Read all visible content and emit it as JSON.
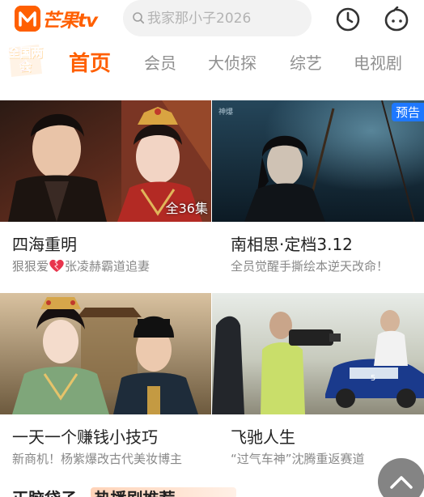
{
  "header": {
    "logo_text": "芒果tv",
    "search_placeholder": "我家那小子2026",
    "brand_color": "#ff5f00"
  },
  "nav": {
    "badge_text": "全国两会",
    "tabs": [
      {
        "label": "首页",
        "active": true
      },
      {
        "label": "会员",
        "active": false
      },
      {
        "label": "大侦探",
        "active": false
      },
      {
        "label": "综艺",
        "active": false
      },
      {
        "label": "电视剧",
        "active": false
      }
    ]
  },
  "cards": [
    {
      "title": "四海重明",
      "subtitle_prefix": "狠狠爱",
      "subtitle_suffix": "张凌赫霸道追妻",
      "overlay": "全36集"
    },
    {
      "title": "南相思·定档3.12",
      "subtitle": "全员觉醒手撕绘本逆天改命！",
      "corner_tag": "预告",
      "channel_mark": "神爆"
    },
    {
      "title": "一天一个赚钱小技巧",
      "subtitle": "新商机！杨紫爆改古代美妆博主"
    },
    {
      "title": "飞驰人生",
      "subtitle": "“过气车神”沈腾重返赛道"
    }
  ],
  "promo": {
    "text": "正脑袋子 · 热播剧推荐"
  },
  "icons": {
    "history": "clock-icon",
    "user": "mango-face-icon",
    "back_to_top": "chevron-up-icon",
    "search": "search-icon"
  }
}
